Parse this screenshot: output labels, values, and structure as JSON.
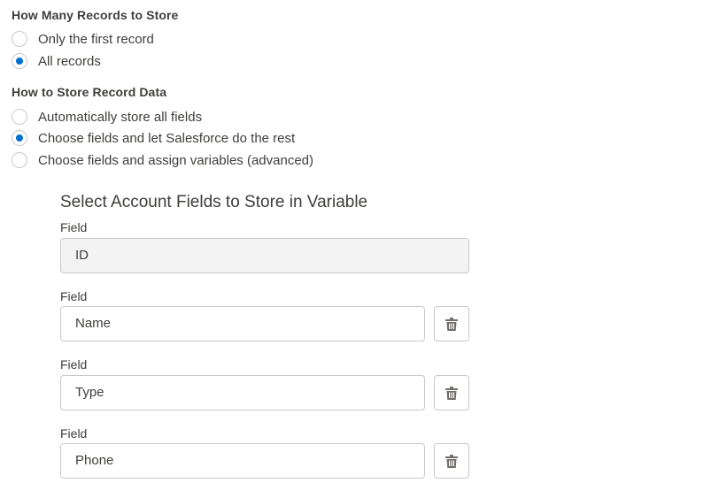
{
  "records_section": {
    "title": "How Many Records to Store",
    "options": [
      {
        "label": "Only the first record",
        "selected": false
      },
      {
        "label": "All records",
        "selected": true
      }
    ]
  },
  "storage_section": {
    "title": "How to Store Record Data",
    "options": [
      {
        "label": "Automatically store all fields",
        "selected": false
      },
      {
        "label": "Choose fields and let Salesforce do the rest",
        "selected": true
      },
      {
        "label": "Choose fields and assign variables (advanced)",
        "selected": false
      }
    ]
  },
  "fields_panel": {
    "heading": "Select Account Fields to Store in Variable",
    "fields": [
      {
        "label": "Field",
        "value": "ID",
        "disabled": true
      },
      {
        "label": "Field",
        "value": "Name",
        "disabled": false
      },
      {
        "label": "Field",
        "value": "Type",
        "disabled": false
      },
      {
        "label": "Field",
        "value": "Phone",
        "disabled": false
      }
    ],
    "delete_icon": "trash-icon"
  },
  "colors": {
    "accent": "#0070d2",
    "border": "#c9c9c9",
    "text": "#3e3e3c",
    "disabled_bg": "#f3f3f3"
  }
}
